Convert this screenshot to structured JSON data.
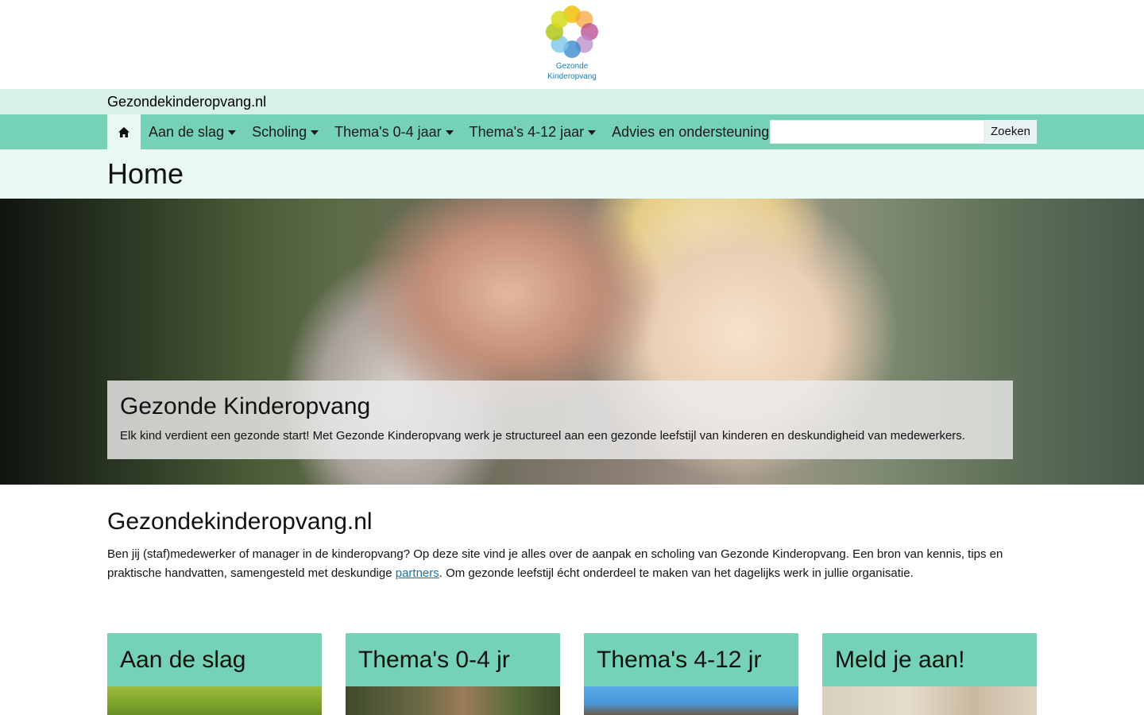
{
  "logo": {
    "line1": "Gezonde",
    "line2": "Kinderopvang"
  },
  "site": {
    "name": "Gezondekinderopvang.nl"
  },
  "nav": {
    "home_icon": "home-icon",
    "items": [
      {
        "label": "Aan de slag"
      },
      {
        "label": "Scholing"
      },
      {
        "label": "Thema's 0-4 jaar"
      },
      {
        "label": "Thema's 4-12 jaar"
      },
      {
        "label": "Advies en ondersteuning"
      }
    ],
    "search": {
      "value": "",
      "button": "Zoeken"
    }
  },
  "page": {
    "title": "Home"
  },
  "hero": {
    "title": "Gezonde Kinderopvang",
    "text": "Elk kind verdient een gezonde start! Met Gezonde Kinderopvang werk je structureel aan een gezonde leefstijl van kinderen en deskundigheid van medewerkers."
  },
  "intro": {
    "title": "Gezondekinderopvang.nl",
    "text_before": "Ben jij (staf)medewerker of manager in de kinderopvang? Op deze site vind je alles over de aanpak en scholing van Gezonde Kinderopvang. Een bron van kennis, tips en praktische handvatten, samengesteld met deskundige ",
    "link": "partners",
    "text_after": ". Om gezonde leefstijl écht onderdeel te maken van het dagelijks werk in jullie organisatie."
  },
  "cards": [
    {
      "title": "Aan de slag"
    },
    {
      "title": "Thema's 0-4 jr"
    },
    {
      "title": "Thema's 4-12 jr"
    },
    {
      "title": "Meld je aan!"
    }
  ],
  "colors": {
    "nav": "#76d2b6",
    "site_bar": "#d7f1e9",
    "title_band": "#eaf8f3",
    "link": "#1f6fa8"
  }
}
